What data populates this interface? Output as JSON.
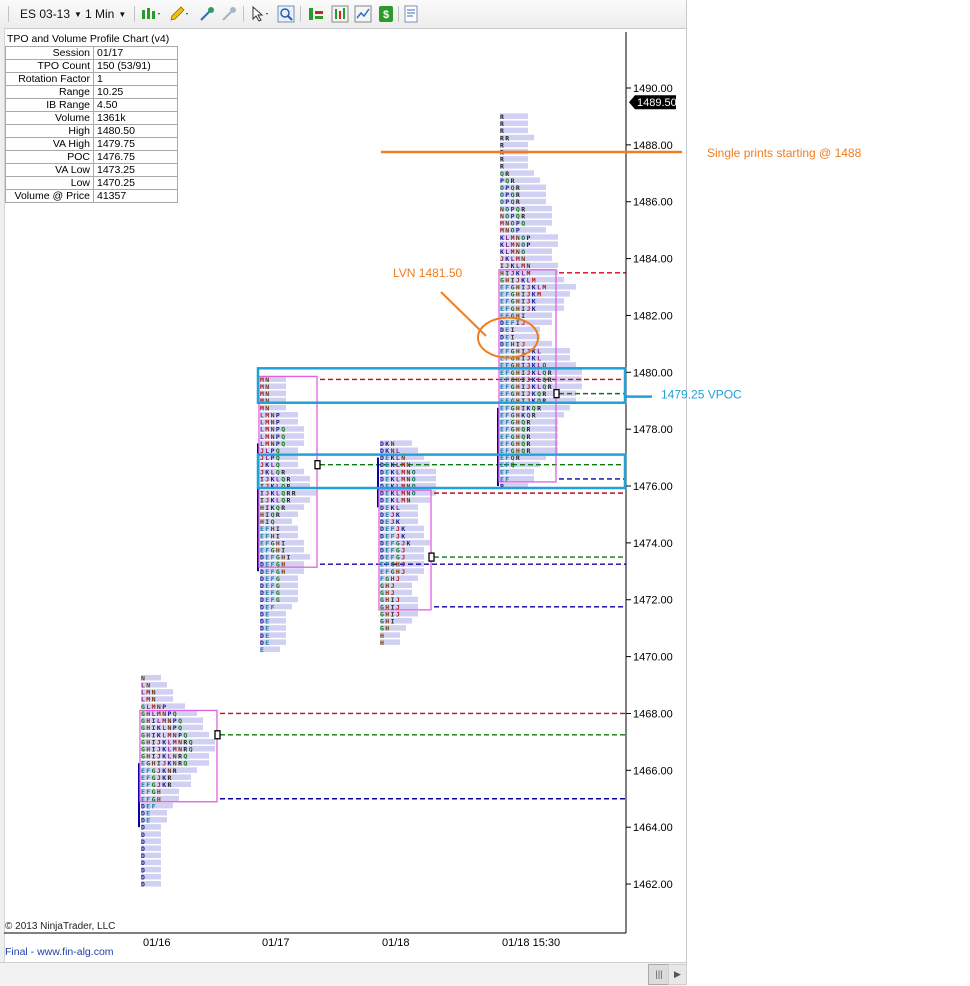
{
  "toolbar": {
    "instrument": "ES 03-13",
    "interval": "1 Min",
    "icons": [
      "bar-style-icon",
      "pencil-draw-icon",
      "cursor-crosshair-icon",
      "eraser-icon",
      "pointer-select-icon",
      "zoom-icon",
      "strategies-icon",
      "indicators-icon",
      "chart-trader-icon",
      "dollar-icon",
      "properties-icon"
    ]
  },
  "info_panel": {
    "title": "TPO and Volume Profile Chart (v4)",
    "rows": [
      {
        "label": "Session",
        "value": "01/17"
      },
      {
        "label": "TPO Count",
        "value": "150 (53/91)"
      },
      {
        "label": "Rotation Factor",
        "value": "1"
      },
      {
        "label": "Range",
        "value": "10.25"
      },
      {
        "label": "IB Range",
        "value": "4.50"
      },
      {
        "label": "Volume",
        "value": "1361k"
      },
      {
        "label": "High",
        "value": "1480.50"
      },
      {
        "label": "VA High",
        "value": "1479.75"
      },
      {
        "label": "POC",
        "value": "1476.75"
      },
      {
        "label": "VA Low",
        "value": "1473.25"
      },
      {
        "label": "Low",
        "value": "1470.25"
      },
      {
        "label": "Volume @ Price",
        "value": "41357"
      }
    ]
  },
  "copyright": "© 2013 NinjaTrader, LLC",
  "status_text": "Final - www.fin-alg.com",
  "colors": {
    "poc_green": "#0a7a0a",
    "va_high_red": "#d8001c",
    "va_low_blue": "#0b00a8",
    "value_area_box": "#e060e0",
    "volume_bar": "#c8c8f0",
    "annotation_orange": "#f07d1e",
    "annotation_blue": "#1fa2d8"
  },
  "chart_data": {
    "type": "market-profile",
    "y_axis": {
      "min": 1460.5,
      "max": 1491.5,
      "ticks": [
        1462,
        1464,
        1466,
        1468,
        1470,
        1472,
        1474,
        1476,
        1478,
        1480,
        1482,
        1484,
        1486,
        1488,
        1490
      ],
      "tick_labels": [
        "1462.00",
        "1464.00",
        "1466.00",
        "1468.00",
        "1470.00",
        "1472.00",
        "1474.00",
        "1476.00",
        "1478.00",
        "1480.00",
        "1482.00",
        "1484.00",
        "1486.00",
        "1488.00",
        "1490.00"
      ]
    },
    "x_labels": [
      "01/16",
      "01/17",
      "01/18",
      "01/18 15:30"
    ],
    "last_price": 1489.5,
    "last_price_label": "1489.50",
    "sessions": [
      {
        "label": "01/16",
        "low": 1462.0,
        "high": 1469.0,
        "va_high": 1468.0,
        "va_low": 1465.0,
        "poc": 1467.25,
        "ib_low": 1464.0,
        "ib_high": 1466.25,
        "tpos": [
          "D",
          "D",
          "D",
          "D",
          "D",
          "D",
          "D",
          "D",
          "D",
          "DE",
          "DE",
          "DEF",
          "EFGH",
          "EFGH",
          "EFGJKR",
          "EFGJKR",
          "EFGJKNR",
          "EGHIJKNRQ",
          "GHIJKLNRQ",
          "GHIJKLMNRQ",
          "GHIJKLMNRQ",
          "GHIKLMNPQ",
          "GHIKLNPQ",
          "GHILMNPQ",
          "GHLMNPQ",
          "GLMNP",
          "LMN",
          "LMN",
          "LN",
          "N"
        ]
      },
      {
        "label": "01/17",
        "low": 1470.25,
        "high": 1480.5,
        "va_high": 1479.75,
        "va_low": 1473.25,
        "poc": 1476.75,
        "ib_low": 1473.0,
        "ib_high": 1477.5,
        "tpos": [
          "E",
          "DE",
          "DE",
          "DE",
          "DE",
          "DE",
          "DEF",
          "DEFG",
          "DEFG",
          "DEFG",
          "DEFG",
          "DEFGH",
          "DEFGH",
          "DEFGHI",
          "EFGHI",
          "EFGHI",
          "EFHI",
          "EFHI",
          "HIQ",
          "HIQR",
          "HIKQR",
          "IJKLQR",
          "IJKLQRR",
          "IJKLQR",
          "IJKLQR",
          "JKLQR",
          "JKLQ",
          "JLPQ",
          "JLPQ",
          "LMNPQ",
          "LMNPQ",
          "LMNPQ",
          "LMNP",
          "LMNP",
          "MN",
          "MN",
          "MN",
          "MN",
          "MN"
        ]
      },
      {
        "label": "01/18",
        "low": 1470.5,
        "high": 1477.5,
        "va_high": 1475.75,
        "va_low": 1471.75,
        "poc": 1473.5,
        "ib_low": 1475.25,
        "ib_high": 1477.0,
        "tpos": [
          "H",
          "H",
          "GH",
          "GHI",
          "GHIJ",
          "GHIJ",
          "GHIJ",
          "GHJ",
          "GHJ",
          "FGHJ",
          "EFGHJ",
          "EFGHJ",
          "DEFGJ",
          "DEFGJ",
          "DEFGJK",
          "DEFJK",
          "DEFJK",
          "DEJK",
          "DEJK",
          "DEKL",
          "DEKLMN",
          "DEKLMNO",
          "DEKLMNO",
          "DEKLMNO",
          "DEKLMNO",
          "DEKLMN",
          "DEKLN",
          "DKNL",
          "DKN"
        ]
      },
      {
        "label": "01/18 15:30",
        "low": 1476.0,
        "high": 1490.0,
        "va_high": 1483.5,
        "va_low": 1476.25,
        "poc": 1479.25,
        "ib_low": 1476.0,
        "ib_high": 1478.75,
        "tpos": [
          "P",
          "EF",
          "EF",
          "EFQ",
          "EFQR",
          "EFGHQR",
          "EFGHQR",
          "EFGHQR",
          "EFGHQR",
          "EFGHQR",
          "EFGHKQR",
          "EFGHIKQR",
          "EFGHIJKQR",
          "EFGHIJKQR",
          "EFGHIJKLQR",
          "EFGHIJKLQR",
          "EFGHIJKLQR",
          "EFGHIJKLQ",
          "EFGHIJKL",
          "EFGHIJKL",
          "DEHIJ",
          "DEI",
          "DEI",
          "DEFIJ",
          "EFGHI",
          "EFGHIJK",
          "EFGHIJK",
          "EFGHIJKM",
          "EFGHIJKLM",
          "GHIJKLM",
          "HIJKLM",
          "IJKLMN",
          "JKLMN",
          "KLMNO",
          "KLMNOP",
          "KLMNOP",
          "MNOP",
          "MNOPQ",
          "NOPQR",
          "NOPQR",
          "OPQR",
          "OPQR",
          "OPQR",
          "PQR",
          "QR",
          "R",
          "R",
          "R",
          "R",
          "RR",
          "R",
          "R",
          "R"
        ]
      }
    ]
  },
  "annotations": {
    "single_prints": {
      "text": "Single prints starting @ 1488",
      "price": 1487.75
    },
    "lvn": {
      "text": "LVN 1481.50",
      "price": 1481.5
    },
    "vpoc": {
      "text": "1479.25 VPOC",
      "price": 1479.25
    }
  }
}
